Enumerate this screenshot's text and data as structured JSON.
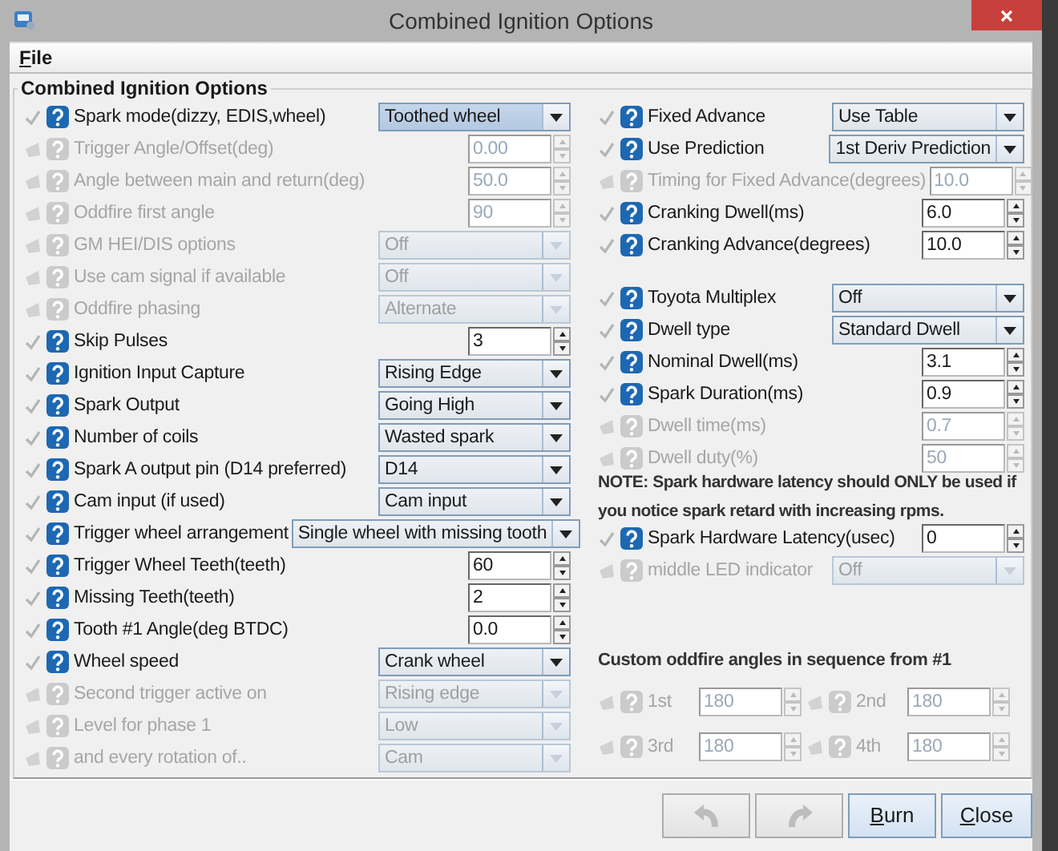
{
  "window": {
    "title": "Combined Ignition Options"
  },
  "menu": [
    {
      "label": "File"
    }
  ],
  "panel": {
    "title": "Combined Ignition Options"
  },
  "left_rows": [
    {
      "label": "Spark mode(dizzy, EDIS,wheel)",
      "kind": "combo",
      "value": "Toothed wheel",
      "enabled": true,
      "focused": true
    },
    {
      "label": "Trigger Angle/Offset(deg)",
      "kind": "spin",
      "value": "0.00",
      "enabled": false
    },
    {
      "label": "Angle between main and return(deg)",
      "kind": "spin",
      "value": "50.0",
      "enabled": false
    },
    {
      "label": "Oddfire first angle",
      "kind": "spin",
      "value": "90",
      "enabled": false
    },
    {
      "label": "GM HEI/DIS options",
      "kind": "combo",
      "value": "Off",
      "enabled": false,
      "focused": false
    },
    {
      "label": "Use cam signal if available",
      "kind": "combo",
      "value": "Off",
      "enabled": false,
      "focused": false
    },
    {
      "label": "Oddfire phasing",
      "kind": "combo",
      "value": "Alternate",
      "enabled": false,
      "focused": false
    },
    {
      "label": "Skip Pulses",
      "kind": "spin",
      "value": "3",
      "enabled": true
    },
    {
      "label": "Ignition Input Capture",
      "kind": "combo",
      "value": "Rising Edge",
      "enabled": true,
      "focused": false
    },
    {
      "label": "Spark Output",
      "kind": "combo",
      "value": "Going High",
      "enabled": true,
      "focused": false
    },
    {
      "label": "Number of coils",
      "kind": "combo",
      "value": "Wasted spark",
      "enabled": true,
      "focused": false
    },
    {
      "label": "Spark A output pin (D14 preferred)",
      "kind": "combo",
      "value": "D14",
      "enabled": true,
      "focused": false
    },
    {
      "label": "Cam input (if used)",
      "kind": "combo",
      "value": "Cam input",
      "enabled": true,
      "focused": false
    },
    {
      "label": "Trigger wheel arrangement",
      "kind": "combo",
      "value": "Single wheel with missing tooth",
      "enabled": true,
      "focused": false
    },
    {
      "label": "Trigger Wheel Teeth(teeth)",
      "kind": "spin",
      "value": "60",
      "enabled": true
    },
    {
      "label": "Missing Teeth(teeth)",
      "kind": "spin",
      "value": "2",
      "enabled": true
    },
    {
      "label": "Tooth #1 Angle(deg BTDC)",
      "kind": "spin",
      "value": "0.0",
      "enabled": true
    },
    {
      "label": "Wheel speed",
      "kind": "combo",
      "value": "Crank wheel",
      "enabled": true,
      "focused": false
    },
    {
      "label": "Second trigger active on",
      "kind": "combo",
      "value": "Rising edge",
      "enabled": false,
      "focused": false
    },
    {
      "label": "Level for phase 1",
      "kind": "combo",
      "value": "Low",
      "enabled": false,
      "focused": false
    },
    {
      "label": "and every rotation of..",
      "kind": "combo",
      "value": "Cam",
      "enabled": false,
      "focused": false
    }
  ],
  "right_rows_a": [
    {
      "label": "Fixed Advance",
      "kind": "combo",
      "value": "Use Table",
      "enabled": true,
      "focused": false
    },
    {
      "label": "Use Prediction",
      "kind": "combo",
      "value": "1st Deriv Prediction",
      "enabled": true,
      "focused": false
    },
    {
      "label": "Timing for Fixed Advance(degrees)",
      "kind": "spin",
      "value": "10.0",
      "enabled": false
    },
    {
      "label": "Cranking Dwell(ms)",
      "kind": "spin",
      "value": "6.0",
      "enabled": true
    },
    {
      "label": "Cranking Advance(degrees)",
      "kind": "spin",
      "value": "10.0",
      "enabled": true
    }
  ],
  "right_rows_b": [
    {
      "label": "Toyota Multiplex",
      "kind": "combo",
      "value": "Off",
      "enabled": true,
      "focused": false
    },
    {
      "label": "Dwell type",
      "kind": "combo",
      "value": "Standard Dwell",
      "enabled": true,
      "focused": false
    },
    {
      "label": "Nominal Dwell(ms)",
      "kind": "spin",
      "value": "3.1",
      "enabled": true
    },
    {
      "label": "Spark Duration(ms)",
      "kind": "spin",
      "value": "0.9",
      "enabled": true
    },
    {
      "label": "Dwell time(ms)",
      "kind": "spin",
      "value": "0.7",
      "enabled": false
    },
    {
      "label": "Dwell duty(%)",
      "kind": "spin",
      "value": "50",
      "enabled": false
    }
  ],
  "note": "NOTE: Spark hardware latency should ONLY be used if you notice spark retard with increasing rpms.",
  "right_rows_c": [
    {
      "label": "Spark Hardware Latency(usec)",
      "kind": "spin",
      "value": "0",
      "enabled": true
    },
    {
      "label": "middle LED indicator",
      "kind": "combo",
      "value": "Off",
      "enabled": false,
      "focused": false
    }
  ],
  "oddfire": {
    "heading": "Custom oddfire angles in sequence from #1",
    "angles": [
      {
        "label": "1st",
        "value": "180",
        "enabled": false
      },
      {
        "label": "2nd",
        "value": "180",
        "enabled": false
      },
      {
        "label": "3rd",
        "value": "180",
        "enabled": false
      },
      {
        "label": "4th",
        "value": "180",
        "enabled": false
      }
    ]
  },
  "buttons": [
    {
      "kind": "undo",
      "enabled": false
    },
    {
      "kind": "redo",
      "enabled": false
    },
    {
      "kind": "text",
      "label": "Burn",
      "enabled": true
    },
    {
      "kind": "text",
      "label": "Close",
      "enabled": true
    }
  ]
}
